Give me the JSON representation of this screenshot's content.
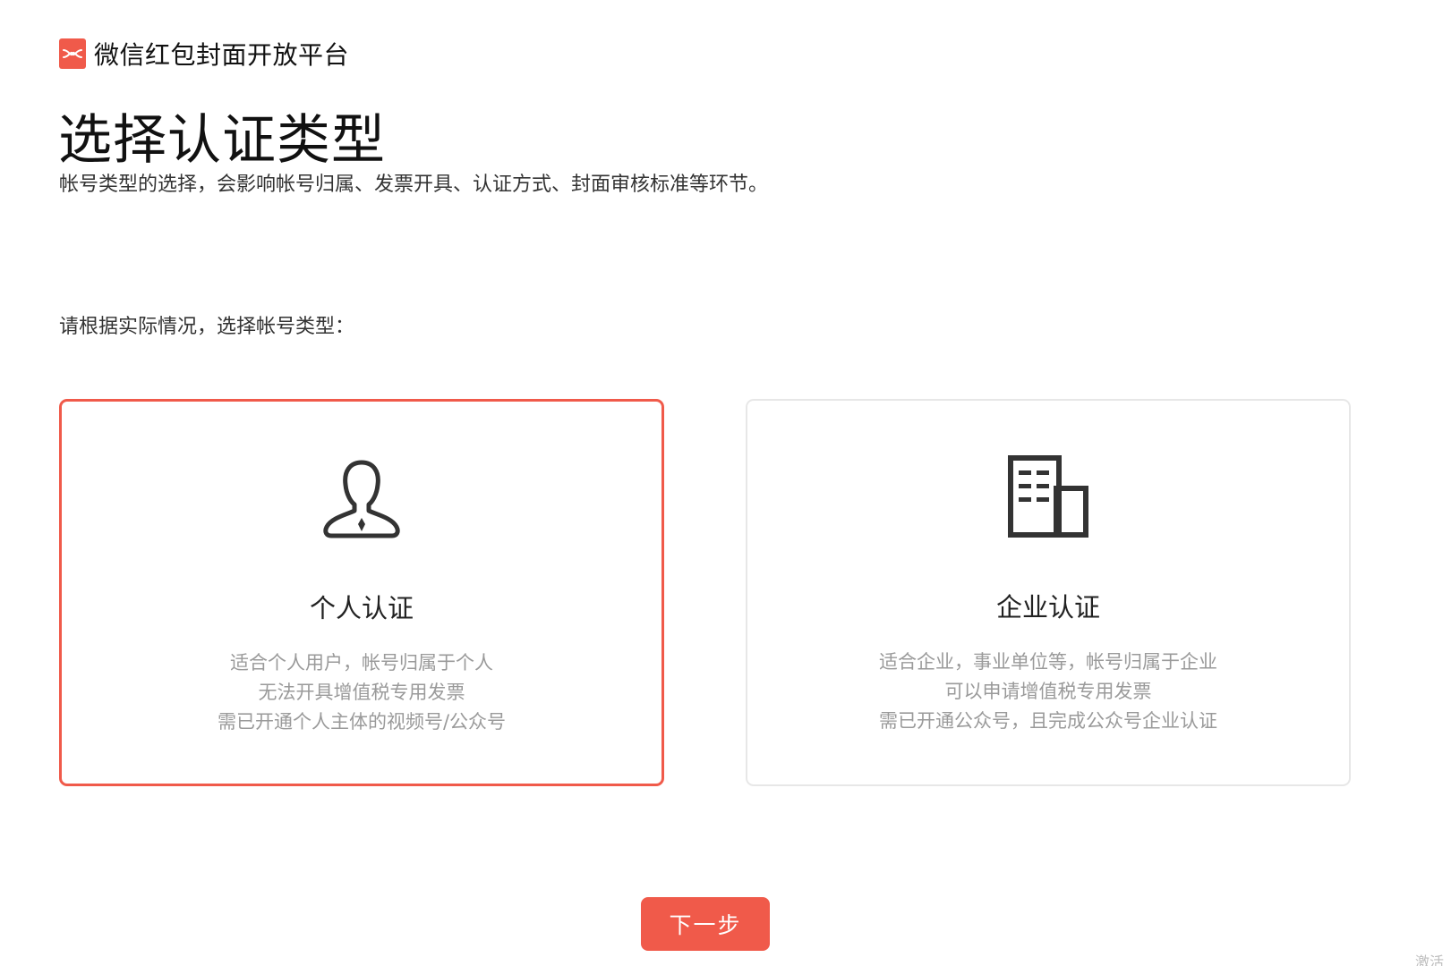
{
  "header": {
    "logo_icon": "red-packet-icon",
    "platform_name": "微信红包封面开放平台",
    "brand_color": "#f05a4a"
  },
  "page": {
    "title": "选择认证类型",
    "subtitle": "帐号类型的选择，会影响帐号归属、发票开具、认证方式、封面审核标准等环节。",
    "prompt": "请根据实际情况，选择帐号类型："
  },
  "cards": [
    {
      "icon": "person-icon",
      "title": "个人认证",
      "selected": true,
      "desc": [
        "适合个人用户，帐号归属于个人",
        "无法开具增值税专用发票",
        "需已开通个人主体的视频号/公众号"
      ]
    },
    {
      "icon": "building-icon",
      "title": "企业认证",
      "selected": false,
      "desc": [
        "适合企业，事业单位等，帐号归属于企业",
        "可以申请增值税专用发票",
        "需已开通公众号，且完成公众号企业认证"
      ]
    }
  ],
  "actions": {
    "next_label": "下一步"
  },
  "watermark": "激活"
}
